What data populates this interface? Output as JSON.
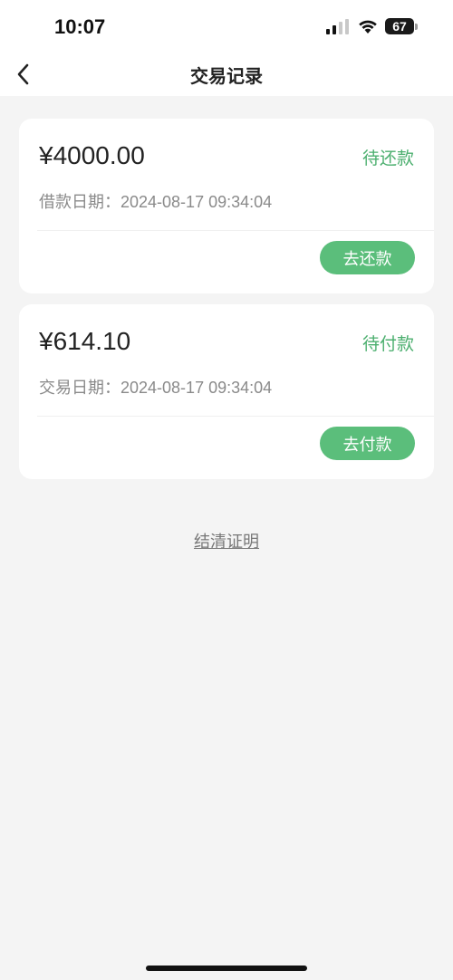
{
  "status_bar": {
    "time": "10:07",
    "battery": "67"
  },
  "header": {
    "title": "交易记录"
  },
  "records": [
    {
      "amount": "¥4000.00",
      "status": "待还款",
      "date_label": "借款日期：",
      "date_value": "2024-08-17 09:34:04",
      "action_label": "去还款"
    },
    {
      "amount": "¥614.10",
      "status": "待付款",
      "date_label": "交易日期：",
      "date_value": "2024-08-17 09:34:04",
      "action_label": "去付款"
    }
  ],
  "footer": {
    "settlement_link": "结清证明"
  },
  "colors": {
    "accent": "#5bbe7b",
    "status_text": "#4caf6f",
    "background": "#f4f4f4"
  }
}
